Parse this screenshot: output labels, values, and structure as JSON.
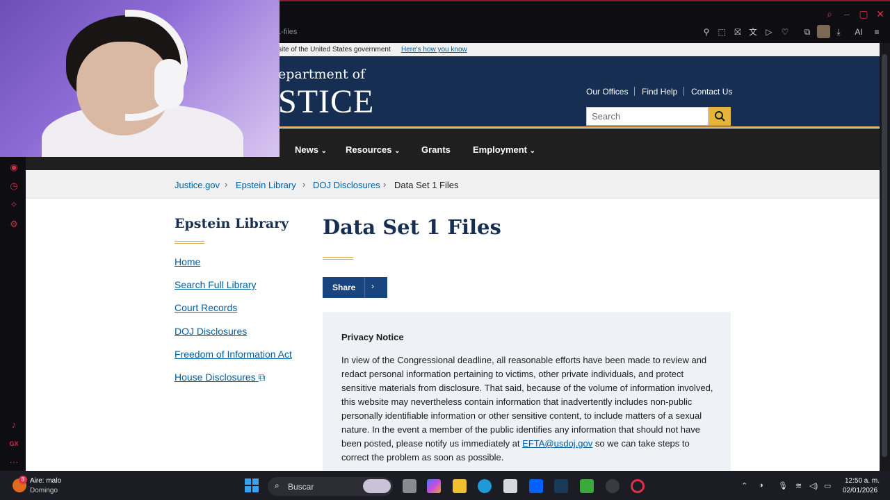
{
  "browser": {
    "url_fragment": "1-files",
    "toolbar_ai_label": "AI"
  },
  "gov_banner": {
    "text": "site of the United States government",
    "link": "Here's how you know"
  },
  "header": {
    "dept_line1": "epartment of",
    "dept_line2": "STICE",
    "links": [
      "Our Offices",
      "Find Help",
      "Contact Us"
    ],
    "search_placeholder": "Search"
  },
  "nav": {
    "items": [
      "News",
      "Resources",
      "Grants",
      "Employment"
    ],
    "chevron": "⌄"
  },
  "breadcrumb": [
    "Justice.gov",
    "Epstein Library",
    "DOJ Disclosures",
    "Data Set 1 Files"
  ],
  "sidebar": {
    "title": "Epstein Library",
    "links": [
      "Home",
      "Search Full Library",
      "Court Records",
      "DOJ Disclosures",
      "Freedom of Information Act",
      "House Disclosures"
    ]
  },
  "main": {
    "title": "Data Set 1 Files",
    "share_label": "Share",
    "notice_title": "Privacy Notice",
    "notice_body_1": "In view of the Congressional deadline, all reasonable efforts have been made to review and redact personal information pertaining to victims, other private individuals, and protect sensitive materials from disclosure.  That said, because of the volume of information involved, this website may nevertheless contain information that inadvertently includes non-public personally identifiable information or other sensitive content, to include matters of a sexual nature.  In the event a member of the public identifies any information that should not have been posted, please notify us immediately at ",
    "notice_email": "EFTA@usdoj.gov",
    "notice_body_2": " so we can take steps to correct the problem as soon as possible."
  },
  "taskbar": {
    "weather_badge": "8",
    "weather_line1": "Aire: malo",
    "weather_line2": "Domingo",
    "search_label": "Buscar",
    "time": "12:50 a. m.",
    "date": "02/01/2026"
  },
  "colors": {
    "header_navy": "#162e51",
    "gold_accent": "#e2ae4b",
    "link_blue": "#005ea2",
    "share_blue": "#1a4480",
    "opera_red": "#e0304e"
  }
}
